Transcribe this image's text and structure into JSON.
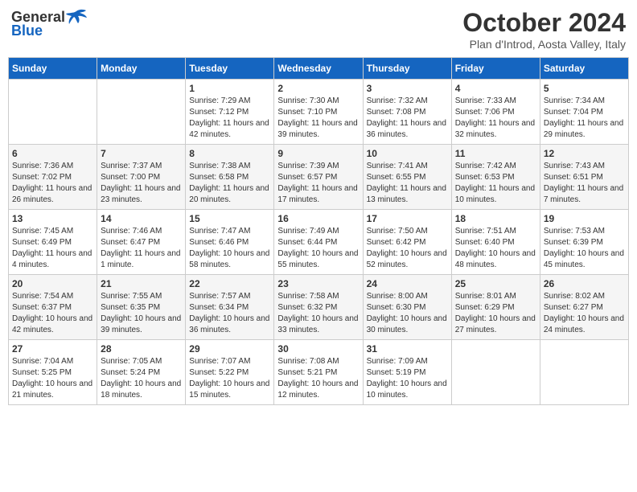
{
  "header": {
    "logo_general": "General",
    "logo_blue": "Blue",
    "month_title": "October 2024",
    "location": "Plan d'Introd, Aosta Valley, Italy"
  },
  "days_of_week": [
    "Sunday",
    "Monday",
    "Tuesday",
    "Wednesday",
    "Thursday",
    "Friday",
    "Saturday"
  ],
  "weeks": [
    [
      {
        "day": "",
        "content": ""
      },
      {
        "day": "",
        "content": ""
      },
      {
        "day": "1",
        "content": "Sunrise: 7:29 AM\nSunset: 7:12 PM\nDaylight: 11 hours and 42 minutes."
      },
      {
        "day": "2",
        "content": "Sunrise: 7:30 AM\nSunset: 7:10 PM\nDaylight: 11 hours and 39 minutes."
      },
      {
        "day": "3",
        "content": "Sunrise: 7:32 AM\nSunset: 7:08 PM\nDaylight: 11 hours and 36 minutes."
      },
      {
        "day": "4",
        "content": "Sunrise: 7:33 AM\nSunset: 7:06 PM\nDaylight: 11 hours and 32 minutes."
      },
      {
        "day": "5",
        "content": "Sunrise: 7:34 AM\nSunset: 7:04 PM\nDaylight: 11 hours and 29 minutes."
      }
    ],
    [
      {
        "day": "6",
        "content": "Sunrise: 7:36 AM\nSunset: 7:02 PM\nDaylight: 11 hours and 26 minutes."
      },
      {
        "day": "7",
        "content": "Sunrise: 7:37 AM\nSunset: 7:00 PM\nDaylight: 11 hours and 23 minutes."
      },
      {
        "day": "8",
        "content": "Sunrise: 7:38 AM\nSunset: 6:58 PM\nDaylight: 11 hours and 20 minutes."
      },
      {
        "day": "9",
        "content": "Sunrise: 7:39 AM\nSunset: 6:57 PM\nDaylight: 11 hours and 17 minutes."
      },
      {
        "day": "10",
        "content": "Sunrise: 7:41 AM\nSunset: 6:55 PM\nDaylight: 11 hours and 13 minutes."
      },
      {
        "day": "11",
        "content": "Sunrise: 7:42 AM\nSunset: 6:53 PM\nDaylight: 11 hours and 10 minutes."
      },
      {
        "day": "12",
        "content": "Sunrise: 7:43 AM\nSunset: 6:51 PM\nDaylight: 11 hours and 7 minutes."
      }
    ],
    [
      {
        "day": "13",
        "content": "Sunrise: 7:45 AM\nSunset: 6:49 PM\nDaylight: 11 hours and 4 minutes."
      },
      {
        "day": "14",
        "content": "Sunrise: 7:46 AM\nSunset: 6:47 PM\nDaylight: 11 hours and 1 minute."
      },
      {
        "day": "15",
        "content": "Sunrise: 7:47 AM\nSunset: 6:46 PM\nDaylight: 10 hours and 58 minutes."
      },
      {
        "day": "16",
        "content": "Sunrise: 7:49 AM\nSunset: 6:44 PM\nDaylight: 10 hours and 55 minutes."
      },
      {
        "day": "17",
        "content": "Sunrise: 7:50 AM\nSunset: 6:42 PM\nDaylight: 10 hours and 52 minutes."
      },
      {
        "day": "18",
        "content": "Sunrise: 7:51 AM\nSunset: 6:40 PM\nDaylight: 10 hours and 48 minutes."
      },
      {
        "day": "19",
        "content": "Sunrise: 7:53 AM\nSunset: 6:39 PM\nDaylight: 10 hours and 45 minutes."
      }
    ],
    [
      {
        "day": "20",
        "content": "Sunrise: 7:54 AM\nSunset: 6:37 PM\nDaylight: 10 hours and 42 minutes."
      },
      {
        "day": "21",
        "content": "Sunrise: 7:55 AM\nSunset: 6:35 PM\nDaylight: 10 hours and 39 minutes."
      },
      {
        "day": "22",
        "content": "Sunrise: 7:57 AM\nSunset: 6:34 PM\nDaylight: 10 hours and 36 minutes."
      },
      {
        "day": "23",
        "content": "Sunrise: 7:58 AM\nSunset: 6:32 PM\nDaylight: 10 hours and 33 minutes."
      },
      {
        "day": "24",
        "content": "Sunrise: 8:00 AM\nSunset: 6:30 PM\nDaylight: 10 hours and 30 minutes."
      },
      {
        "day": "25",
        "content": "Sunrise: 8:01 AM\nSunset: 6:29 PM\nDaylight: 10 hours and 27 minutes."
      },
      {
        "day": "26",
        "content": "Sunrise: 8:02 AM\nSunset: 6:27 PM\nDaylight: 10 hours and 24 minutes."
      }
    ],
    [
      {
        "day": "27",
        "content": "Sunrise: 7:04 AM\nSunset: 5:25 PM\nDaylight: 10 hours and 21 minutes."
      },
      {
        "day": "28",
        "content": "Sunrise: 7:05 AM\nSunset: 5:24 PM\nDaylight: 10 hours and 18 minutes."
      },
      {
        "day": "29",
        "content": "Sunrise: 7:07 AM\nSunset: 5:22 PM\nDaylight: 10 hours and 15 minutes."
      },
      {
        "day": "30",
        "content": "Sunrise: 7:08 AM\nSunset: 5:21 PM\nDaylight: 10 hours and 12 minutes."
      },
      {
        "day": "31",
        "content": "Sunrise: 7:09 AM\nSunset: 5:19 PM\nDaylight: 10 hours and 10 minutes."
      },
      {
        "day": "",
        "content": ""
      },
      {
        "day": "",
        "content": ""
      }
    ]
  ]
}
